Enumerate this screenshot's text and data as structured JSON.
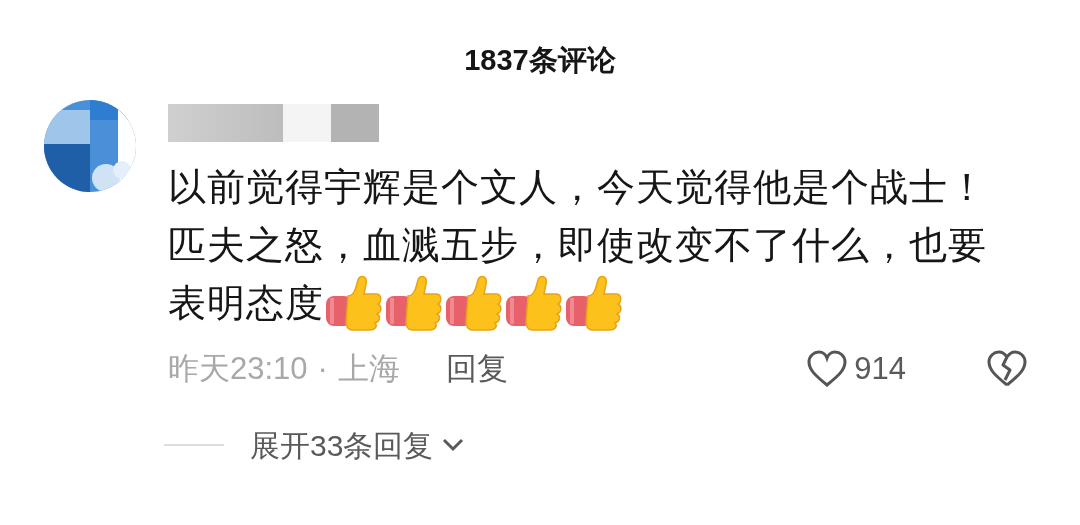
{
  "header": {
    "title": "1837条评论"
  },
  "comment": {
    "author": {
      "kind": "redacted"
    },
    "lines": [
      "以前觉得宇辉是个文人，今天觉得他是个战士！",
      "匹夫之怒，血溅五步，即使改变不了什么，也要",
      "表明态度"
    ],
    "emojis": [
      {
        "kind": "thumbs_up"
      },
      {
        "kind": "thumbs_up"
      },
      {
        "kind": "thumbs_up"
      },
      {
        "kind": "thumbs_up"
      },
      {
        "kind": "thumbs_up"
      }
    ],
    "time": "昨天23:10",
    "separator": "·",
    "location": "上海",
    "reply_label": "回复",
    "likes": "914",
    "liked": false,
    "disliked": false,
    "expand_replies": "展开33条回复"
  }
}
